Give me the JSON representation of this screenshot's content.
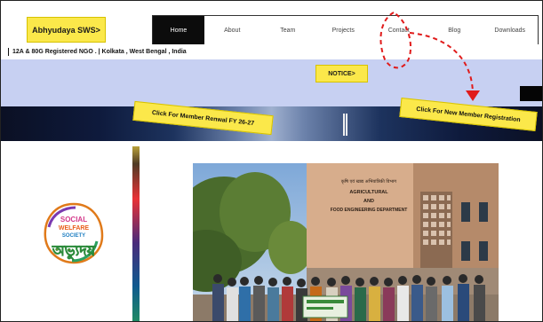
{
  "header": {
    "brand_label": "Abhyudaya SWS>",
    "nav": [
      {
        "label": "Home",
        "active": true
      },
      {
        "label": "About",
        "active": false
      },
      {
        "label": "Team",
        "active": false
      },
      {
        "label": "Projects",
        "active": false
      },
      {
        "label": "Contact",
        "active": false
      },
      {
        "label": "Blog",
        "active": false
      },
      {
        "label": "Downloads",
        "active": false
      }
    ]
  },
  "info_bar": {
    "text": "12A & 80G Registered NGO . | Kolkata , West Bengal , India"
  },
  "notice": {
    "label": "NOTICE>"
  },
  "banner": {
    "renew_label": "Click For Member Renwal FY 26-27",
    "register_label": "Click For New Member Registration"
  },
  "logo": {
    "line1": "SOCIAL",
    "line2": "WELFARE",
    "line3": "SOCIETY",
    "script_text": "অভ্যুদয়"
  },
  "photo": {
    "sign_lines": [
      "कृषि एवं खाद्य अभियांत्रिकी विभाग",
      "AGRICULTURAL",
      "AND",
      "FOOD ENGINEERING DEPARTMENT"
    ]
  },
  "colors": {
    "accent_yellow": "#fbe84a",
    "notice_band": "#c7d0f2",
    "annotation_red": "#e01b1b"
  }
}
